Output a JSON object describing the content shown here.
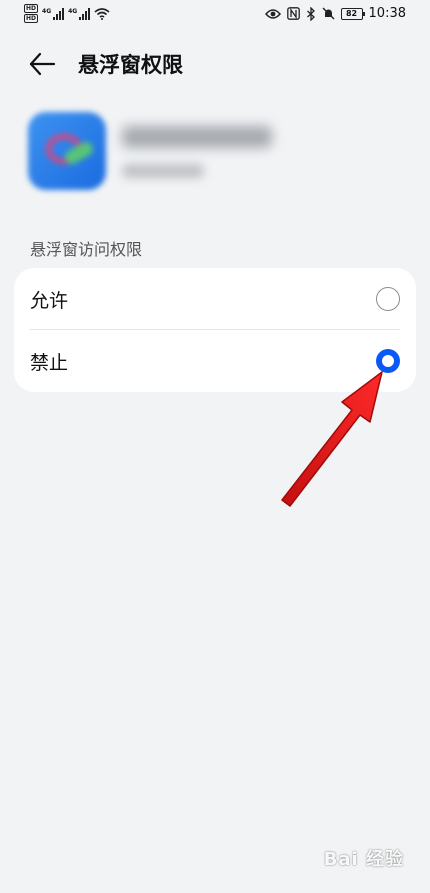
{
  "status_bar": {
    "hd1": "HD",
    "hd2": "HD",
    "net1": "4G",
    "net2": "4G",
    "battery": "82",
    "time": "10:38",
    "icons": [
      "eye-icon",
      "nfc-icon",
      "bluetooth-icon",
      "mute-icon"
    ]
  },
  "header": {
    "title": "悬浮窗权限"
  },
  "section": {
    "label": "悬浮窗访问权限"
  },
  "options": [
    {
      "label": "允许",
      "selected": false
    },
    {
      "label": "禁止",
      "selected": true
    }
  ],
  "colors": {
    "accent": "#0a59f7",
    "background": "#f1f3f5",
    "card": "#ffffff",
    "annotation_arrow": "#e81919"
  },
  "watermark": {
    "text": "Bai 经验"
  }
}
